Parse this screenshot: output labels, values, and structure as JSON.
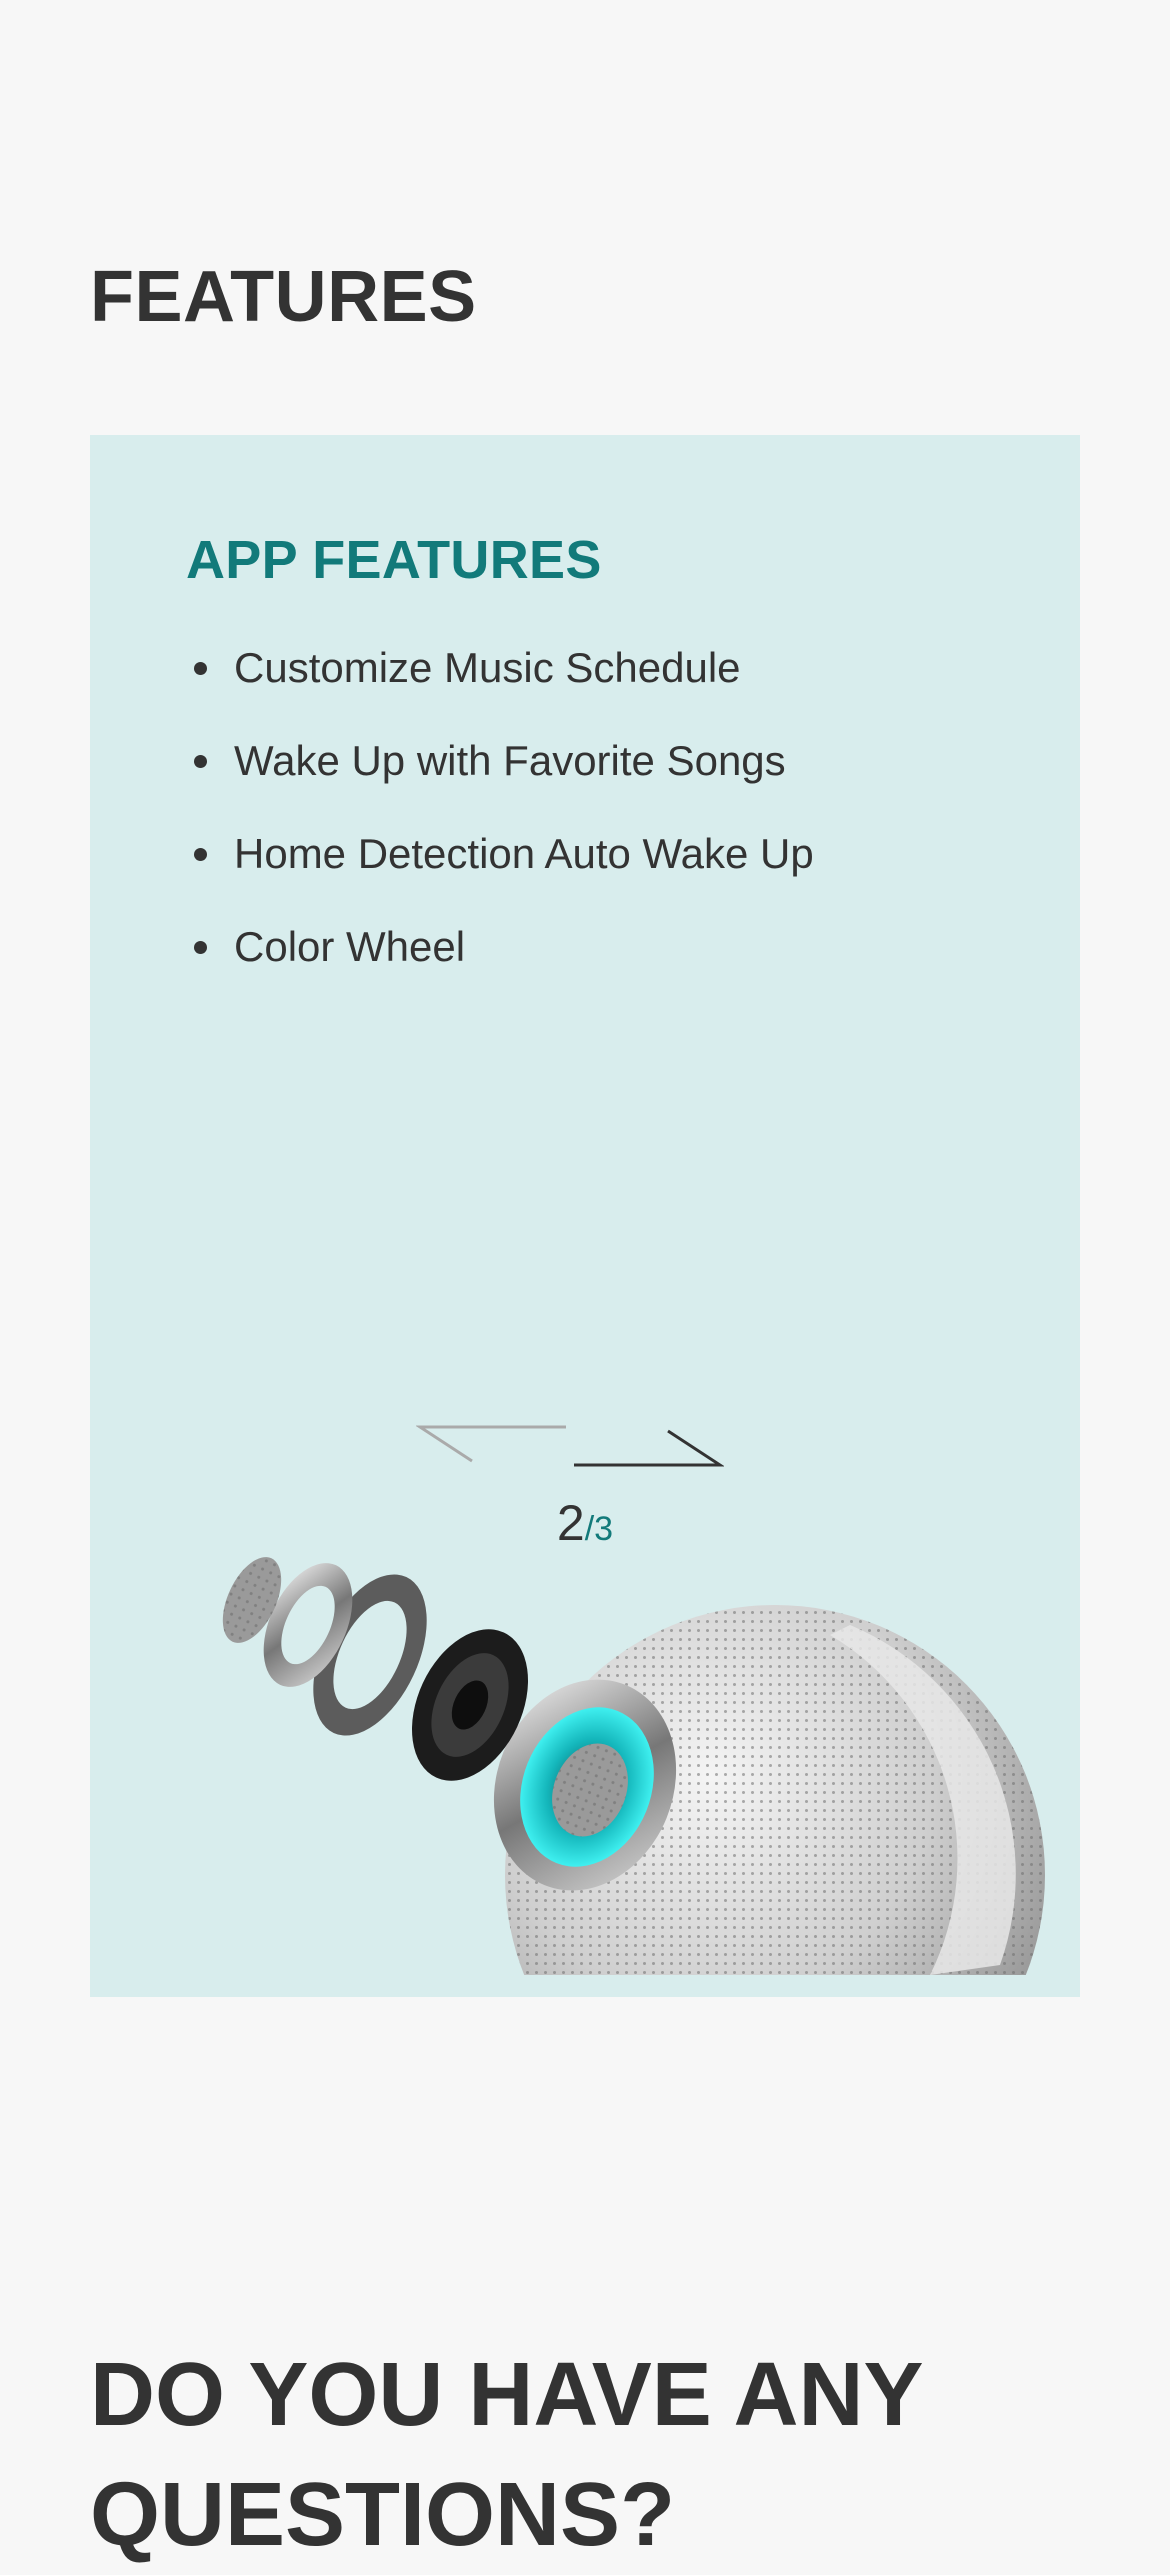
{
  "features": {
    "title": "FEATURES",
    "card": {
      "title": "APP FEATURES",
      "items": [
        {
          "label": "Customize Music Schedule"
        },
        {
          "label": "Wake Up with Favorite Songs"
        },
        {
          "label": "Home Detection Auto Wake Up"
        },
        {
          "label": "Color Wheel"
        }
      ],
      "pager": {
        "current": "2",
        "separator": "/",
        "total": "3"
      },
      "image_icon": "speaker-exploded-view-icon"
    }
  },
  "questions": {
    "title": "DO YOU HAVE ANY QUESTIONS?"
  },
  "colors": {
    "background": "#f7f7f7",
    "card_background": "#d8eded",
    "accent": "#127a7a",
    "text": "#333333"
  }
}
